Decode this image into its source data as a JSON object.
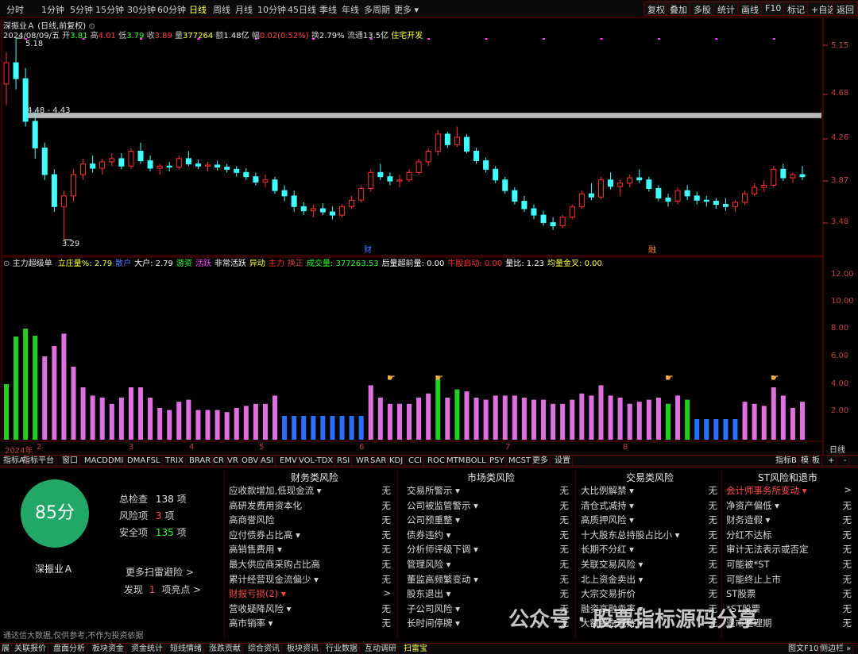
{
  "topbar": {
    "timeframes": [
      "分时",
      "1分钟",
      "5分钟",
      "15分钟",
      "30分钟",
      "60分钟",
      "日线",
      "周线",
      "月线",
      "10分钟",
      "45日线",
      "季线",
      "年线",
      "多周期",
      "更多 ▾"
    ],
    "active_timeframe": "日线",
    "right_buttons": [
      "复权",
      "叠加",
      "多股",
      "统计",
      "画线",
      "F10",
      "标记",
      "+自选",
      "返回"
    ]
  },
  "stock": {
    "name": "深振业Ａ",
    "mode": "(日线,前复权)",
    "date": "2024/08/09/五",
    "open_label": "开",
    "open": "3.81",
    "high_label": "高",
    "high": "4.01",
    "low_label": "低",
    "low": "3.79",
    "close_label": "收",
    "close": "3.89",
    "vol_label": "量",
    "vol": "377264",
    "amount_label": "额",
    "amount": "1.48亿",
    "change_label": "幅",
    "change": "0.02(0.52%)",
    "turnover_label": "换",
    "turnover": "2.79%",
    "float_label": "流通",
    "float": "13.5亿",
    "sector": "住宅开发"
  },
  "price_labels": {
    "max": "5.18",
    "min": "3.29",
    "band": "4.48 - 4.43"
  },
  "price_axis": [
    "5.15",
    "4.68",
    "4.26",
    "3.87",
    "3.48"
  ],
  "vol_axis": [
    "12.00",
    "10.00",
    "8.00",
    "6.00",
    "4.00",
    "2.00"
  ],
  "date_axis": {
    "year": "2024年",
    "months": [
      "2",
      "3",
      "4",
      "5",
      "6",
      "7",
      "8"
    ],
    "period": "日线"
  },
  "markers": {
    "cai1": "财",
    "cai2": "融"
  },
  "indicator": {
    "name": "主力超级单",
    "items": [
      {
        "label": "立庄量%: 2.79",
        "color": "#ffff40"
      },
      {
        "label": "散户",
        "color": "#4a7cff"
      },
      {
        "label": "大户: 2.79",
        "color": "#ffffff"
      },
      {
        "label": "游资",
        "color": "#30ff30"
      },
      {
        "label": "活跃",
        "color": "#ff40ff"
      },
      {
        "label": "非常活跃",
        "color": "#ffffff"
      },
      {
        "label": "异动",
        "color": "#ffff40"
      },
      {
        "label": "主力",
        "color": "#ff3030"
      },
      {
        "label": "换正",
        "color": "#cc4444"
      },
      {
        "label": "成交量: 377263.53",
        "color": "#30ff30"
      },
      {
        "label": "后量超前量: 0.00",
        "color": "#ffffff"
      },
      {
        "label": "牛股启动: 0.00",
        "color": "#ff3030"
      },
      {
        "label": "量比: 1.23",
        "color": "#ffffff"
      },
      {
        "label": "均量金叉: 0.00",
        "color": "#ffff40"
      }
    ]
  },
  "tabs": [
    "指标A",
    "指标平台",
    "窗口",
    "MACD",
    "DMI",
    "DMA",
    "FSL",
    "TRIX",
    "BRAR",
    "CR",
    "VR",
    "OBV",
    "ASI",
    "EMV",
    "VOL-TDX",
    "RSI",
    "WR",
    "SAR",
    "KDJ",
    "CCI",
    "ROC",
    "MTM",
    "BOLL",
    "PSY",
    "MCST",
    "更多",
    "设置"
  ],
  "tabs_right": [
    "指标B",
    "模",
    "板",
    "+",
    "-"
  ],
  "scan": {
    "score": "85分",
    "stock_name": "深振业Ａ",
    "check_label": "总检查",
    "check_value": "138",
    "check_unit": "项",
    "risk_label": "风险项",
    "risk_value": "3",
    "risk_unit": "项",
    "safe_label": "安全项",
    "safe_value": "135",
    "safe_unit": "项",
    "more_link": "更多扫雷避险 >",
    "found_prefix": "发现",
    "found_value": "1",
    "found_suffix": "项亮点 >",
    "disclaimer": "通达信大数据,仅供参考,不作为投资依据"
  },
  "columns": [
    {
      "title": "财务类风险",
      "rows": [
        {
          "name": "应收款增加,低现金流 ▾",
          "value": "无"
        },
        {
          "name": "高研发费用资本化",
          "value": "无"
        },
        {
          "name": "高商誉风险",
          "value": "无"
        },
        {
          "name": "应付债券占比高 ▾",
          "value": "无"
        },
        {
          "name": "高销售费用 ▾",
          "value": "无"
        },
        {
          "name": "最大供应商采购占比高",
          "value": "无"
        },
        {
          "name": "累计经营现金流偏少 ▾",
          "value": "无"
        },
        {
          "name": "财报亏损(2) ▾",
          "value": ">",
          "warn": true
        },
        {
          "name": "营收疑降风险 ▾",
          "value": "无"
        },
        {
          "name": "高市销率 ▾",
          "value": "无"
        }
      ]
    },
    {
      "title": "市场类风险",
      "rows": [
        {
          "name": "交易所警示 ▾",
          "value": "无"
        },
        {
          "name": "公司被监管警示 ▾",
          "value": "无"
        },
        {
          "name": "公司预重整 ▾",
          "value": "无"
        },
        {
          "name": "债券违约 ▾",
          "value": "无"
        },
        {
          "name": "分析师评级下调 ▾",
          "value": "无"
        },
        {
          "name": "管理风险 ▾",
          "value": "无"
        },
        {
          "name": "董监高频繁变动 ▾",
          "value": "无"
        },
        {
          "name": "股东退出 ▾",
          "value": "无"
        },
        {
          "name": "子公司风险 ▾",
          "value": "无"
        },
        {
          "name": "长时间停牌 ▾",
          "value": "无"
        }
      ]
    },
    {
      "title": "交易类风险",
      "rows": [
        {
          "name": "大比例解禁 ▾",
          "value": "无"
        },
        {
          "name": "清仓式减持 ▾",
          "value": "无"
        },
        {
          "name": "高质押风险 ▾",
          "value": "无"
        },
        {
          "name": "十大股东总持股占比小 ▾",
          "value": "无"
        },
        {
          "name": "长期不分红 ▾",
          "value": "无"
        },
        {
          "name": "关联交易风险 ▾",
          "value": "无"
        },
        {
          "name": "北上资金卖出 ▾",
          "value": "无"
        },
        {
          "name": "大宗交易折价",
          "value": "无"
        },
        {
          "name": "融资高融卖率 ▾",
          "value": "无"
        },
        {
          "name": "大额股东减持 ▾",
          "value": "无"
        }
      ]
    },
    {
      "title": "ST风险和退市",
      "rows": [
        {
          "name": "会计师事务所变动 ▾",
          "value": ">",
          "warn": true
        },
        {
          "name": "净资产偏低 ▾",
          "value": "无"
        },
        {
          "name": "财务造假 ▾",
          "value": "无"
        },
        {
          "name": "分红不达标",
          "value": "无"
        },
        {
          "name": "审计无法表示或否定",
          "value": "无"
        },
        {
          "name": "可能被*ST",
          "value": "无"
        },
        {
          "name": "可能终止上市",
          "value": "无"
        },
        {
          "name": "ST股票",
          "value": "无"
        },
        {
          "name": "*ST股票",
          "value": "无"
        },
        {
          "name": "退市整理期",
          "value": "无"
        }
      ]
    }
  ],
  "watermark": "公众号 · 股票指标源码分享",
  "bottombar": [
    "展",
    "关联报价",
    "盘面分析",
    "板块资金",
    "资金统计",
    "短线情绪",
    "涨跌贡献",
    "综合资讯",
    "板块资讯",
    "行业数据",
    "互动调研",
    "扫雷宝"
  ],
  "bottombar_active": "扫雷宝",
  "bottombar_right": [
    "图文F10",
    "侧边栏 »"
  ],
  "chart_data": {
    "type": "candlestick",
    "title": "深振业Ａ (日线,前复权)",
    "x_range": [
      "2024-01",
      "2024-08-09"
    ],
    "ylim": [
      3.2,
      5.3
    ],
    "up_color": "#ff3030",
    "down_color": "#40ffff",
    "ohlc": [
      [
        4.75,
        5.05,
        4.55,
        4.95
      ],
      [
        4.95,
        5.18,
        4.7,
        4.8
      ],
      [
        4.8,
        4.9,
        4.35,
        4.4
      ],
      [
        4.4,
        4.5,
        4.05,
        4.15
      ],
      [
        4.15,
        4.2,
        3.85,
        3.9
      ],
      [
        3.9,
        3.95,
        3.55,
        3.6
      ],
      [
        3.6,
        3.75,
        3.29,
        3.7
      ],
      [
        3.7,
        3.95,
        3.65,
        3.9
      ],
      [
        3.9,
        4.05,
        3.85,
        4.0
      ],
      [
        4.0,
        4.08,
        3.92,
        3.96
      ],
      [
        3.96,
        4.05,
        3.9,
        4.02
      ],
      [
        4.02,
        4.1,
        3.98,
        4.05
      ],
      [
        4.05,
        4.1,
        3.95,
        3.98
      ],
      [
        3.98,
        4.15,
        3.95,
        4.12
      ],
      [
        4.12,
        4.2,
        4.0,
        4.03
      ],
      [
        4.03,
        4.08,
        3.93,
        3.96
      ],
      [
        3.96,
        4.0,
        3.9,
        3.98
      ],
      [
        3.98,
        4.02,
        3.93,
        3.97
      ],
      [
        3.97,
        4.08,
        3.95,
        4.05
      ],
      [
        4.05,
        4.12,
        3.98,
        4.0
      ],
      [
        4.0,
        4.04,
        3.95,
        3.98
      ],
      [
        3.98,
        4.02,
        3.93,
        3.99
      ],
      [
        3.99,
        4.03,
        3.94,
        3.97
      ],
      [
        3.97,
        4.0,
        3.92,
        3.95
      ],
      [
        3.95,
        3.98,
        3.88,
        3.92
      ],
      [
        3.92,
        3.96,
        3.85,
        3.88
      ],
      [
        3.88,
        3.92,
        3.8,
        3.83
      ],
      [
        3.83,
        3.9,
        3.78,
        3.85
      ],
      [
        3.85,
        3.88,
        3.72,
        3.75
      ],
      [
        3.75,
        3.8,
        3.65,
        3.7
      ],
      [
        3.7,
        3.75,
        3.55,
        3.6
      ],
      [
        3.6,
        3.64,
        3.52,
        3.56
      ],
      [
        3.56,
        3.62,
        3.5,
        3.58
      ],
      [
        3.58,
        3.63,
        3.52,
        3.55
      ],
      [
        3.55,
        3.6,
        3.48,
        3.52
      ],
      [
        3.52,
        3.62,
        3.5,
        3.6
      ],
      [
        3.6,
        3.7,
        3.58,
        3.66
      ],
      [
        3.66,
        3.8,
        3.64,
        3.77
      ],
      [
        3.77,
        3.95,
        3.74,
        3.92
      ],
      [
        3.92,
        4.0,
        3.85,
        3.88
      ],
      [
        3.88,
        3.92,
        3.8,
        3.84
      ],
      [
        3.84,
        3.9,
        3.78,
        3.85
      ],
      [
        3.85,
        3.95,
        3.83,
        3.92
      ],
      [
        3.92,
        4.05,
        3.9,
        4.02
      ],
      [
        4.02,
        4.15,
        3.98,
        4.12
      ],
      [
        4.12,
        4.32,
        4.08,
        4.28
      ],
      [
        4.28,
        4.3,
        4.15,
        4.18
      ],
      [
        4.18,
        4.35,
        4.16,
        4.25
      ],
      [
        4.25,
        4.28,
        4.1,
        4.12
      ],
      [
        4.12,
        4.15,
        4.0,
        4.03
      ],
      [
        4.03,
        4.06,
        3.92,
        3.95
      ],
      [
        3.95,
        3.98,
        3.82,
        3.85
      ],
      [
        3.85,
        3.88,
        3.72,
        3.75
      ],
      [
        3.75,
        3.78,
        3.62,
        3.65
      ],
      [
        3.65,
        3.7,
        3.55,
        3.58
      ],
      [
        3.58,
        3.62,
        3.48,
        3.52
      ],
      [
        3.52,
        3.56,
        3.42,
        3.45
      ],
      [
        3.45,
        3.5,
        3.38,
        3.42
      ],
      [
        3.42,
        3.52,
        3.4,
        3.5
      ],
      [
        3.5,
        3.62,
        3.48,
        3.6
      ],
      [
        3.6,
        3.75,
        3.58,
        3.72
      ],
      [
        3.72,
        3.82,
        3.66,
        3.69
      ],
      [
        3.69,
        3.88,
        3.67,
        3.85
      ],
      [
        3.85,
        3.92,
        3.76,
        3.79
      ],
      [
        3.79,
        3.85,
        3.7,
        3.82
      ],
      [
        3.82,
        3.9,
        3.78,
        3.87
      ],
      [
        3.87,
        3.95,
        3.82,
        3.85
      ],
      [
        3.85,
        3.88,
        3.74,
        3.77
      ],
      [
        3.77,
        3.8,
        3.65,
        3.68
      ],
      [
        3.68,
        3.72,
        3.6,
        3.65
      ],
      [
        3.65,
        3.78,
        3.62,
        3.75
      ],
      [
        3.75,
        3.8,
        3.66,
        3.7
      ],
      [
        3.7,
        3.74,
        3.62,
        3.66
      ],
      [
        3.66,
        3.7,
        3.6,
        3.65
      ],
      [
        3.65,
        3.68,
        3.58,
        3.62
      ],
      [
        3.62,
        3.68,
        3.56,
        3.6
      ],
      [
        3.6,
        3.66,
        3.55,
        3.64
      ],
      [
        3.64,
        3.75,
        3.62,
        3.72
      ],
      [
        3.72,
        3.82,
        3.7,
        3.78
      ],
      [
        3.78,
        3.85,
        3.74,
        3.8
      ],
      [
        3.8,
        3.98,
        3.78,
        3.95
      ],
      [
        3.95,
        4.0,
        3.84,
        3.87
      ],
      [
        3.87,
        3.92,
        3.82,
        3.9
      ],
      [
        3.9,
        3.98,
        3.85,
        3.88
      ]
    ]
  }
}
